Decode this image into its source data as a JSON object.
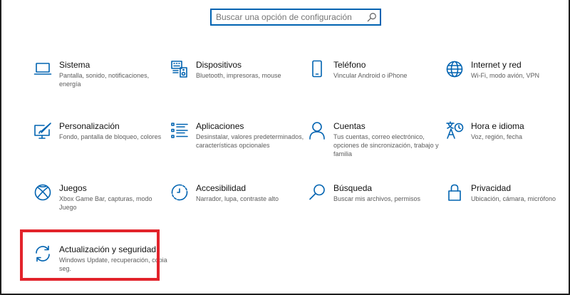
{
  "search": {
    "placeholder": "Buscar una opción de configuración",
    "icon": "search-icon"
  },
  "colors": {
    "accent": "#0063b1",
    "highlight": "#e2232b"
  },
  "tiles": [
    {
      "id": "sistema",
      "icon": "laptop-icon",
      "title": "Sistema",
      "desc": "Pantalla, sonido, notificaciones, energía"
    },
    {
      "id": "dispositivos",
      "icon": "keyboard-speaker-icon",
      "title": "Dispositivos",
      "desc": "Bluetooth, impresoras, mouse"
    },
    {
      "id": "telefono",
      "icon": "phone-icon",
      "title": "Teléfono",
      "desc": "Vincular Android o iPhone"
    },
    {
      "id": "internet",
      "icon": "globe-icon",
      "title": "Internet y red",
      "desc": "Wi-Fi, modo avión, VPN"
    },
    {
      "id": "personalizacion",
      "icon": "paint-icon",
      "title": "Personalización",
      "desc": "Fondo, pantalla de bloqueo, colores"
    },
    {
      "id": "aplicaciones",
      "icon": "apps-list-icon",
      "title": "Aplicaciones",
      "desc": "Desinstalar, valores predeterminados, características opcionales"
    },
    {
      "id": "cuentas",
      "icon": "person-icon",
      "title": "Cuentas",
      "desc": "Tus cuentas, correo electrónico, opciones de sincronización, trabajo y familia"
    },
    {
      "id": "hora",
      "icon": "time-language-icon",
      "title": "Hora e idioma",
      "desc": "Voz, región, fecha"
    },
    {
      "id": "juegos",
      "icon": "xbox-icon",
      "title": "Juegos",
      "desc": "Xbox Game Bar, capturas, modo Juego"
    },
    {
      "id": "accesibilidad",
      "icon": "accessibility-icon",
      "title": "Accesibilidad",
      "desc": "Narrador, lupa, contraste alto"
    },
    {
      "id": "busqueda",
      "icon": "magnifier-icon",
      "title": "Búsqueda",
      "desc": "Buscar mis archivos, permisos"
    },
    {
      "id": "privacidad",
      "icon": "lock-icon",
      "title": "Privacidad",
      "desc": "Ubicación, cámara, micrófono"
    },
    {
      "id": "actualizacion",
      "icon": "sync-icon",
      "title": "Actualización y seguridad",
      "desc": "Windows Update, recuperación, copia seg."
    }
  ]
}
